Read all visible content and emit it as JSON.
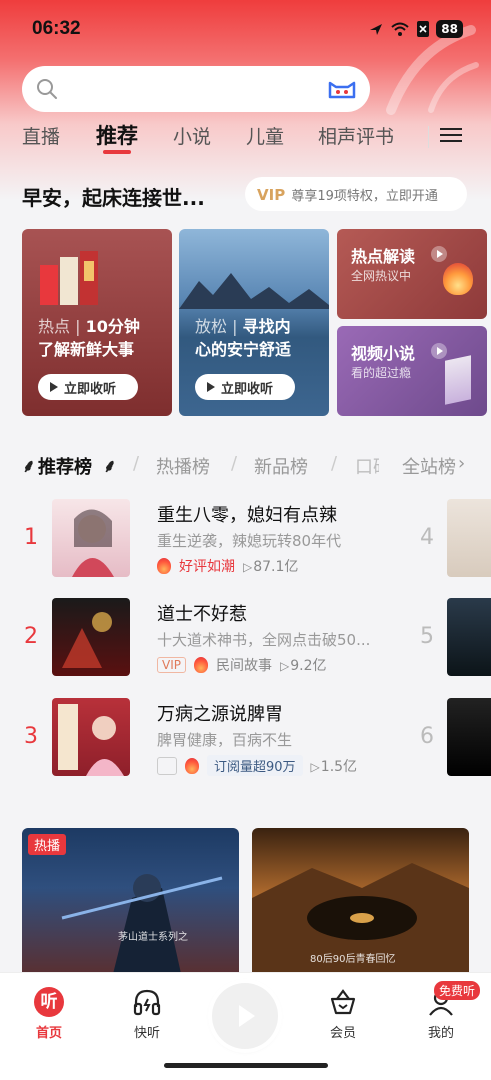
{
  "status_bar": {
    "time": "06:32",
    "battery": "88"
  },
  "search": {
    "placeholder": ""
  },
  "tabs": [
    {
      "label": "直播"
    },
    {
      "label": "推荐"
    },
    {
      "label": "小说"
    },
    {
      "label": "儿童"
    },
    {
      "label": "相声评书"
    }
  ],
  "greeting": "早安，起床连接世...",
  "vip_banner": {
    "vip": "VIP",
    "text": "尊享19项特权，立即开通"
  },
  "cards": {
    "news": {
      "title_dim": "热点 | ",
      "title_a": "10分钟",
      "title_b": "了解新鲜大事",
      "button": "立即收听"
    },
    "relax": {
      "title_dim": "放松 | ",
      "title_a": "寻找内",
      "title_b": "心的安宁舒适",
      "button": "立即收听"
    },
    "hot": {
      "title": "热点解读",
      "subtitle": "全网热议中"
    },
    "video": {
      "title": "视频小说",
      "subtitle": "看的超过瘾"
    }
  },
  "rank_tabs": [
    {
      "label": "推荐榜"
    },
    {
      "label": "热播榜"
    },
    {
      "label": "新品榜"
    },
    {
      "label": "口碑榜"
    },
    {
      "label": "全站榜"
    }
  ],
  "rank_items": [
    {
      "num": "1",
      "title": "重生八零，媳妇有点辣",
      "desc": "重生逆袭，辣媳玩转80年代",
      "badge": "好评如潮",
      "plays": "87.1亿"
    },
    {
      "num": "2",
      "title": "道士不好惹",
      "desc": "十大道术神书，全网点击破50...",
      "vip": "VIP",
      "category": "民间故事",
      "plays": "9.2亿"
    },
    {
      "num": "3",
      "title": "万病之源说脾胃",
      "desc": "脾胃健康，百病不生",
      "badge": "订阅量超90万",
      "plays": "1.5亿"
    }
  ],
  "side_nums": [
    "4",
    "5",
    "6"
  ],
  "promos": {
    "live_badge": "热播",
    "left_sub": "茅山道士系列之",
    "right_sub": "80后90后青春回忆"
  },
  "bottom_nav": {
    "home": {
      "label": "首页",
      "icon_text": "听"
    },
    "quick": {
      "label": "快听"
    },
    "member": {
      "label": "会员"
    },
    "me": {
      "label": "我的",
      "badge": "免费听"
    }
  },
  "colors": {
    "brand": "#e8383d",
    "vip_gold": "#d8a35e"
  }
}
